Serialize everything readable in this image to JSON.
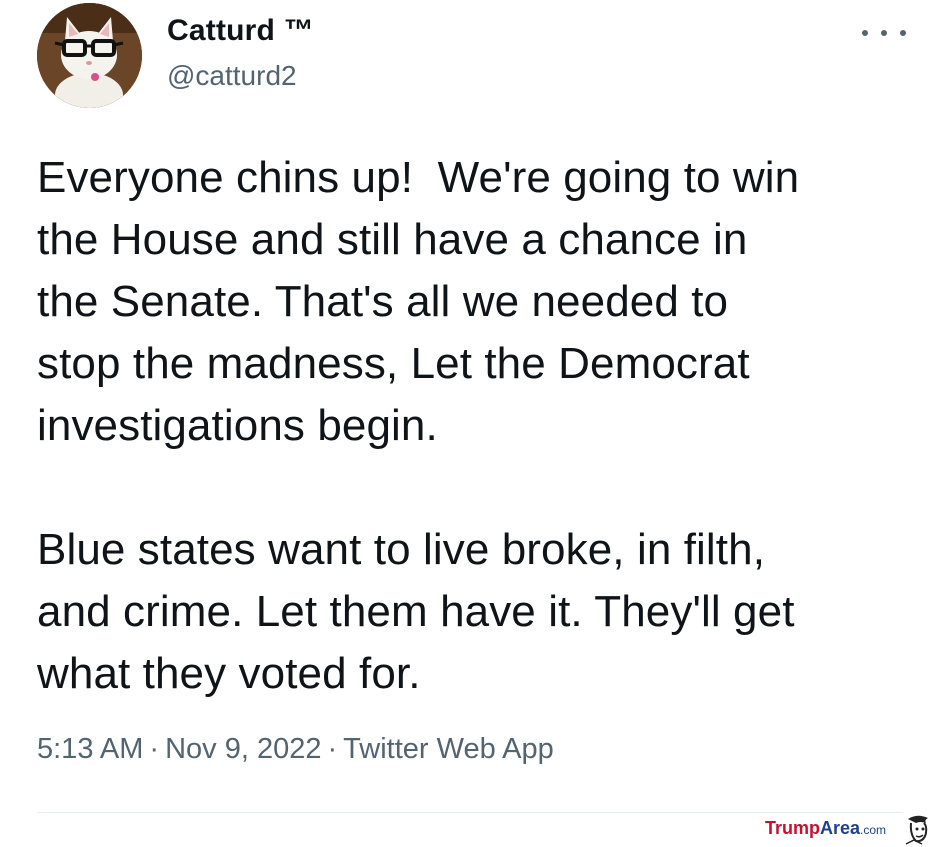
{
  "author": {
    "display_name": "Catturd ™",
    "handle": "@catturd2",
    "avatar_icon": "cat-with-glasses-avatar"
  },
  "menu": {
    "icon": "more-options-icon"
  },
  "tweet": {
    "paragraph_1": "Everyone chins up!  We're going to win\nthe House and still have a chance in\nthe Senate. That's all we needed to\nstop the madness, Let the Democrat\ninvestigations begin.",
    "paragraph_2": "Blue states want to live broke, in filth,\nand crime. Let them have it. They'll get\nwhat they voted for."
  },
  "meta": {
    "time": "5:13 AM",
    "date": "Nov 9, 2022",
    "source": "Twitter Web App",
    "separator": "·"
  },
  "watermark": {
    "part_a": "Trump",
    "part_b": "Area",
    "part_c": ".com",
    "colors": {
      "red": "#c8102e",
      "blue": "#1f3f8f"
    }
  }
}
